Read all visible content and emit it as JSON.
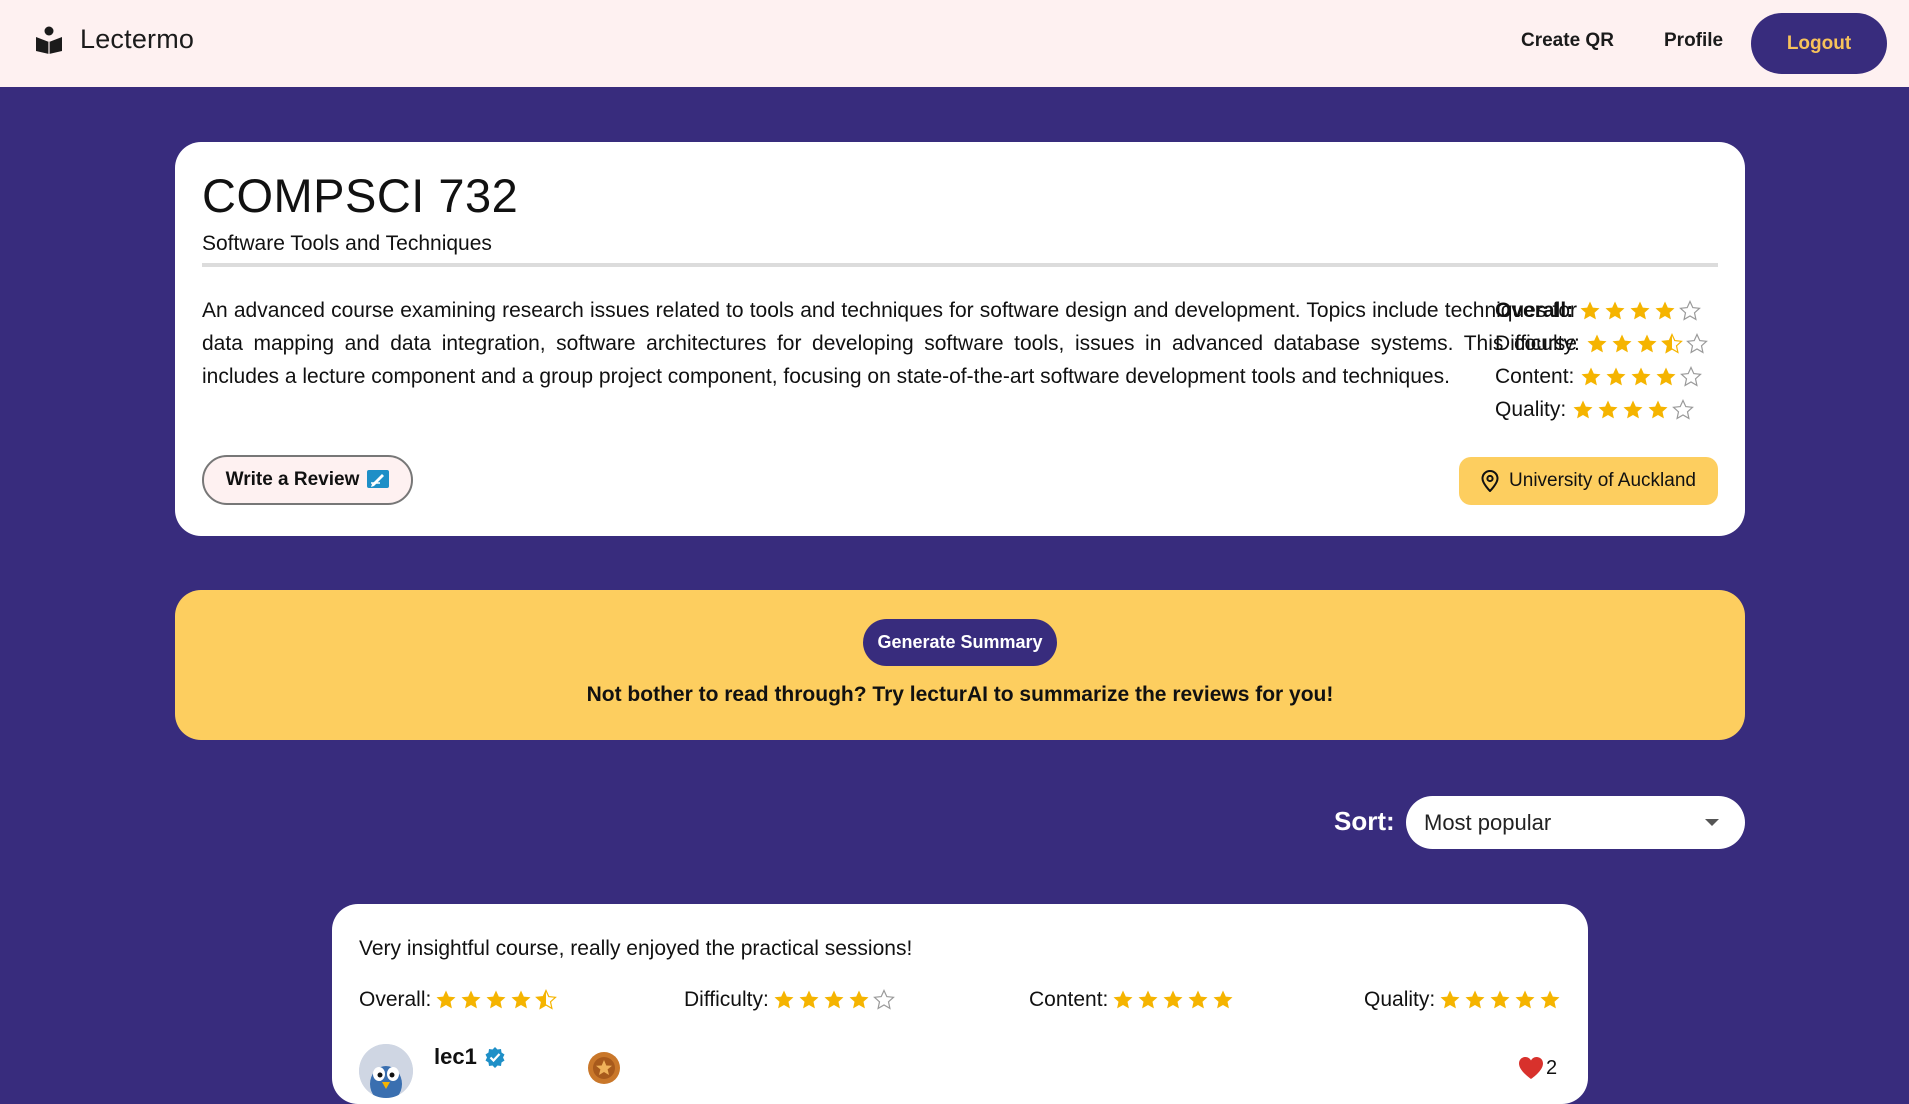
{
  "nav": {
    "brand": "Lectermo",
    "links": [
      "Create QR",
      "Profile"
    ],
    "logout": "Logout"
  },
  "course": {
    "code": "COMPSCI 732",
    "title": "Software Tools and Techniques",
    "description": "An advanced course examining research issues related to tools and techniques for software design and development. Topics include techniques for data mapping and data integration, software architectures for developing software tools, issues in advanced database systems. This course includes a lecture component and a group project component, focusing on state-of-the-art software development tools and techniques.",
    "ratings": [
      {
        "label": "Overall:",
        "value": 4,
        "bold": true
      },
      {
        "label": "Difficulty:",
        "value": 3.5
      },
      {
        "label": "Content:",
        "value": 4
      },
      {
        "label": "Quality:",
        "value": 4
      }
    ],
    "write_review": "Write a Review",
    "university": "University of Auckland"
  },
  "summary": {
    "button": "Generate Summary",
    "text": "Not bother to read through? Try lecturAI to summarize the reviews for you!"
  },
  "sort": {
    "label": "Sort:",
    "selected": "Most popular"
  },
  "review": {
    "text": "Very insightful course, really enjoyed the practical sessions!",
    "ratings": [
      {
        "label": "Overall:",
        "value": 4.5
      },
      {
        "label": "Difficulty:",
        "value": 4
      },
      {
        "label": "Content:",
        "value": 5
      },
      {
        "label": "Quality:",
        "value": 5
      }
    ],
    "username": "lec1",
    "likes": "2"
  },
  "colors": {
    "primary": "#382c7d",
    "accent": "#fdce5f",
    "star": "#f5b400",
    "nav_bg": "#fef1f1"
  }
}
